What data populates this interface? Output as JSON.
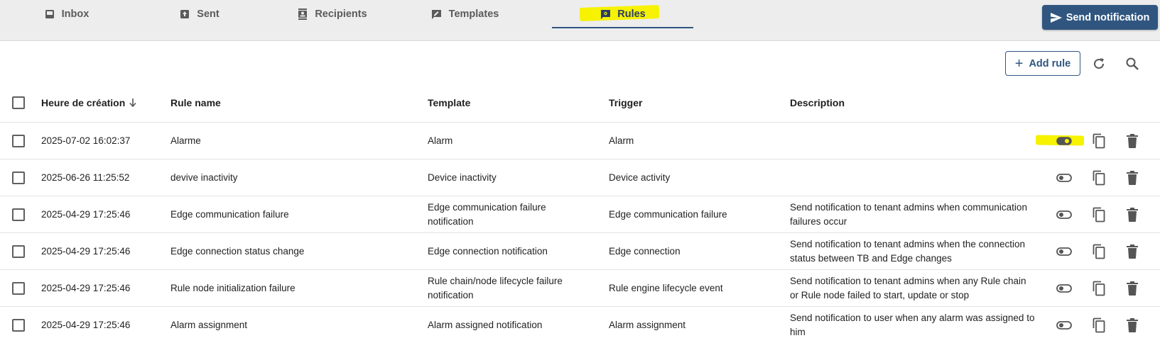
{
  "tabs": [
    {
      "label": "Inbox",
      "icon": "inbox-icon",
      "active": false
    },
    {
      "label": "Sent",
      "icon": "sent-icon",
      "active": false
    },
    {
      "label": "Recipients",
      "icon": "recipients-icon",
      "active": false
    },
    {
      "label": "Templates",
      "icon": "templates-icon",
      "active": false
    },
    {
      "label": "Rules",
      "icon": "rules-icon",
      "active": true
    }
  ],
  "send_button": {
    "label": "Send notification",
    "icon": "send-icon"
  },
  "toolbar": {
    "add_label": "Add rule",
    "refresh_icon": "refresh-icon",
    "search_icon": "search-icon"
  },
  "table": {
    "headers": {
      "date": "Heure de création",
      "name": "Rule name",
      "template": "Template",
      "trigger": "Trigger",
      "description": "Description"
    },
    "rows": [
      {
        "date": "2025-07-02 16:02:37",
        "name": "Alarme",
        "template": "Alarm",
        "trigger": "Alarm",
        "description": "",
        "enabled": true
      },
      {
        "date": "2025-06-26 11:25:52",
        "name": "devive inactivity",
        "template": "Device inactivity",
        "trigger": "Device activity",
        "description": "",
        "enabled": false
      },
      {
        "date": "2025-04-29 17:25:46",
        "name": "Edge communication failure",
        "template": "Edge communication failure notification",
        "trigger": "Edge communication failure",
        "description": "Send notification to tenant admins when communication failures occur",
        "enabled": false
      },
      {
        "date": "2025-04-29 17:25:46",
        "name": "Edge connection status change",
        "template": "Edge connection notification",
        "trigger": "Edge connection",
        "description": "Send notification to tenant admins when the connection status between TB and Edge changes",
        "enabled": false
      },
      {
        "date": "2025-04-29 17:25:46",
        "name": "Rule node initialization failure",
        "template": "Rule chain/node lifecycle failure notification",
        "trigger": "Rule engine lifecycle event",
        "description": "Send notification to tenant admins when any Rule chain or Rule node failed to start, update or stop",
        "enabled": false
      },
      {
        "date": "2025-04-29 17:25:46",
        "name": "Alarm assignment",
        "template": "Alarm assigned notification",
        "trigger": "Alarm assignment",
        "description": "Send notification to user when any alarm was assigned to him",
        "enabled": false
      }
    ]
  },
  "colors": {
    "primary": "#305680",
    "highlight": "#f6f200",
    "background": "#ededed"
  }
}
